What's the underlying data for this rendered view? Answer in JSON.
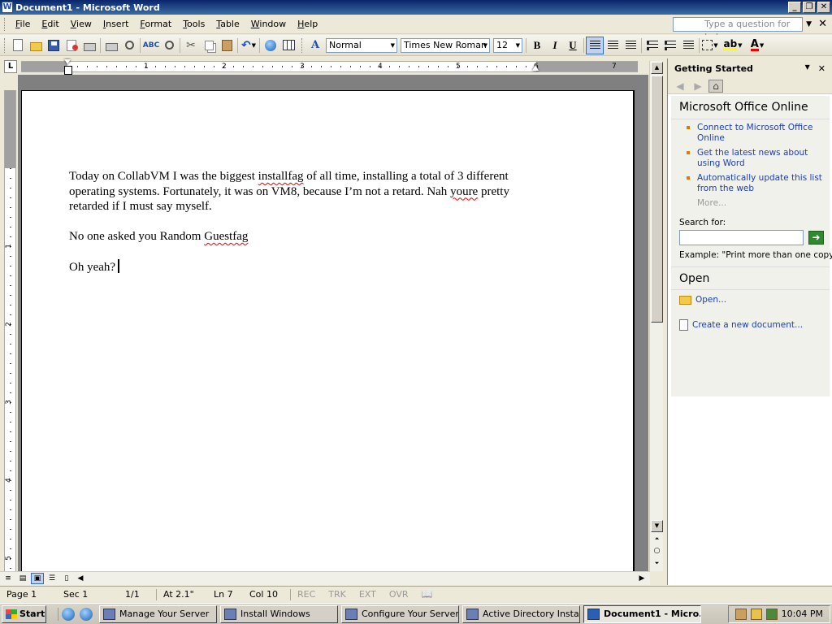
{
  "window": {
    "title": "Document1 - Microsoft Word",
    "icon": "W"
  },
  "menubar": {
    "items": [
      "File",
      "Edit",
      "View",
      "Insert",
      "Format",
      "Tools",
      "Table",
      "Window",
      "Help"
    ],
    "help_placeholder": "Type a question for help"
  },
  "toolbar": {
    "style": "Normal",
    "font": "Times New Roman",
    "size": "12",
    "bold": "B",
    "italic": "I",
    "underline": "U"
  },
  "ruler": {
    "numbers": [
      "1",
      "2",
      "3",
      "4",
      "5",
      "6",
      "7"
    ],
    "v_numbers": [
      "1",
      "2",
      "3",
      "4",
      "5"
    ]
  },
  "document": {
    "paragraphs": [
      {
        "parts": [
          "Today on CollabVM I was the biggest ",
          "installfag",
          " of all time, installing a total of 3 different operating systems. Fortunately, it was on VM8, because I’m not a retard. Nah ",
          "youre",
          " pretty retarded if I must say myself."
        ]
      },
      {
        "parts": [
          "No one asked you Random ",
          "Guestfag"
        ]
      },
      {
        "parts": [
          "Oh yeah?"
        ]
      }
    ]
  },
  "taskpane": {
    "title": "Getting Started",
    "section_title": "Microsoft Office Online",
    "links": [
      "Connect to Microsoft Office Online",
      "Get the latest news about using Word",
      "Automatically update this list from the web"
    ],
    "more": "More...",
    "search_label": "Search for:",
    "search_value": "",
    "example": "Example:  \"Print more than one copy\"",
    "open_title": "Open",
    "open_link": "Open...",
    "create_link": "Create a new document..."
  },
  "statusbar": {
    "page": "Page  1",
    "sec": "Sec  1",
    "pages": "1/1",
    "at": "At  2.1\"",
    "ln": "Ln  7",
    "col": "Col  10",
    "rec": "REC",
    "trk": "TRK",
    "ext": "EXT",
    "ovr": "OVR"
  },
  "taskbar": {
    "start": "Start",
    "tasks": [
      "Manage Your Server",
      "Install Windows",
      "Configure Your Server...",
      "Active Directory Instal...",
      "Document1 - Micro..."
    ],
    "clock": "10:04 PM"
  }
}
